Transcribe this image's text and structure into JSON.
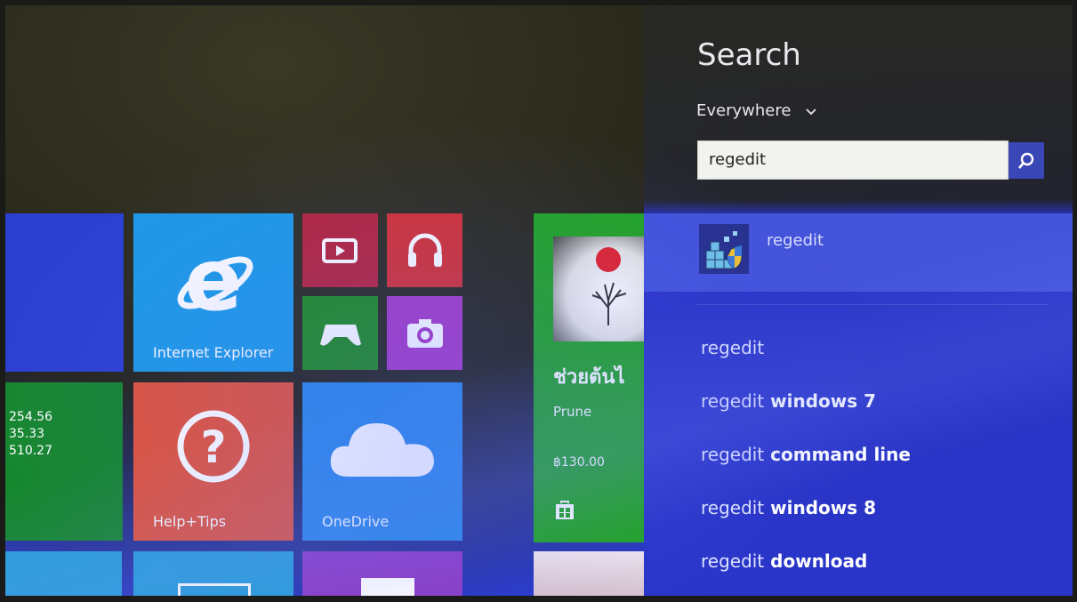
{
  "tiles": {
    "internet_explorer": {
      "label": "Internet Explorer",
      "color": "#1e9ae6"
    },
    "help_tips": {
      "label": "Help+Tips",
      "color": "#e2543a"
    },
    "onedrive": {
      "label": "OneDrive",
      "color": "#2a88e6"
    },
    "video": {
      "color": "#b5243a"
    },
    "music": {
      "color": "#d33131"
    },
    "games": {
      "color": "#1f8c1c"
    },
    "camera": {
      "color": "#a53cc2"
    },
    "finance": {
      "values": [
        "254.56",
        "35.33",
        "510.27"
      ],
      "color": "#16872e"
    },
    "store_app": {
      "title": "ช่วยต้นไ",
      "subtitle": "Prune",
      "price": "฿130.00",
      "color": "#22a522"
    }
  },
  "search_pane": {
    "title": "Search",
    "scope": "Everywhere",
    "query": "regedit",
    "top_result": {
      "label": "regedit",
      "icon": "registry-editor-icon"
    },
    "suggestions": [
      {
        "base": "regedit",
        "rest": ""
      },
      {
        "base": "regedit",
        "rest": " windows 7"
      },
      {
        "base": "regedit",
        "rest": " command line"
      },
      {
        "base": "regedit",
        "rest": " windows 8"
      },
      {
        "base": "regedit",
        "rest": " download"
      }
    ]
  }
}
